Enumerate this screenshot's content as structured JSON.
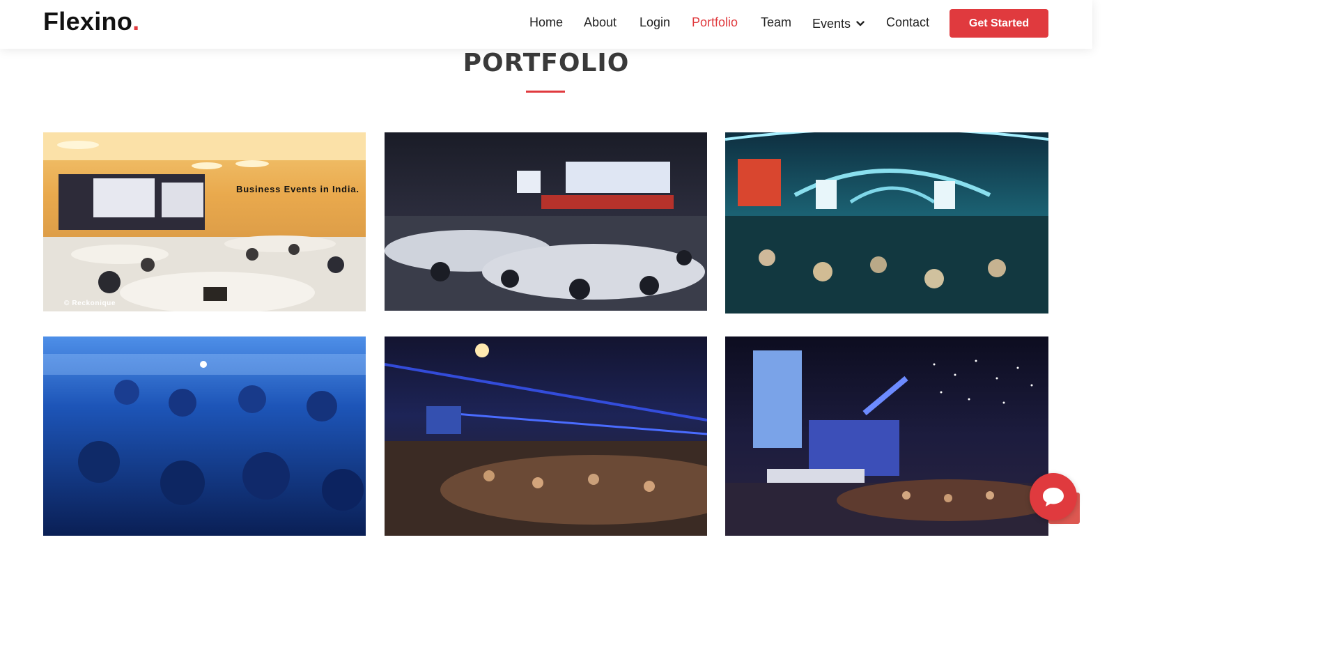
{
  "brand": {
    "name": "Flexino",
    "dot": "."
  },
  "nav": {
    "items": [
      {
        "label": "Home"
      },
      {
        "label": "About"
      },
      {
        "label": "Login"
      },
      {
        "label": "Portfolio",
        "active": true
      },
      {
        "label": "Team"
      },
      {
        "label": "Events",
        "has_dropdown": true
      },
      {
        "label": "Contact"
      }
    ],
    "cta_label": "Get Started"
  },
  "section": {
    "title": "PORTFOLIO"
  },
  "portfolio": {
    "items": [
      {
        "overlay_text": "Business Events in India.",
        "watermark": "© Reckonique"
      },
      {},
      {},
      {},
      {},
      {}
    ]
  },
  "colors": {
    "accent": "#e03a3e"
  },
  "icons": {
    "dropdown": "chevron-down-icon",
    "chat": "chat-bubble-icon"
  }
}
